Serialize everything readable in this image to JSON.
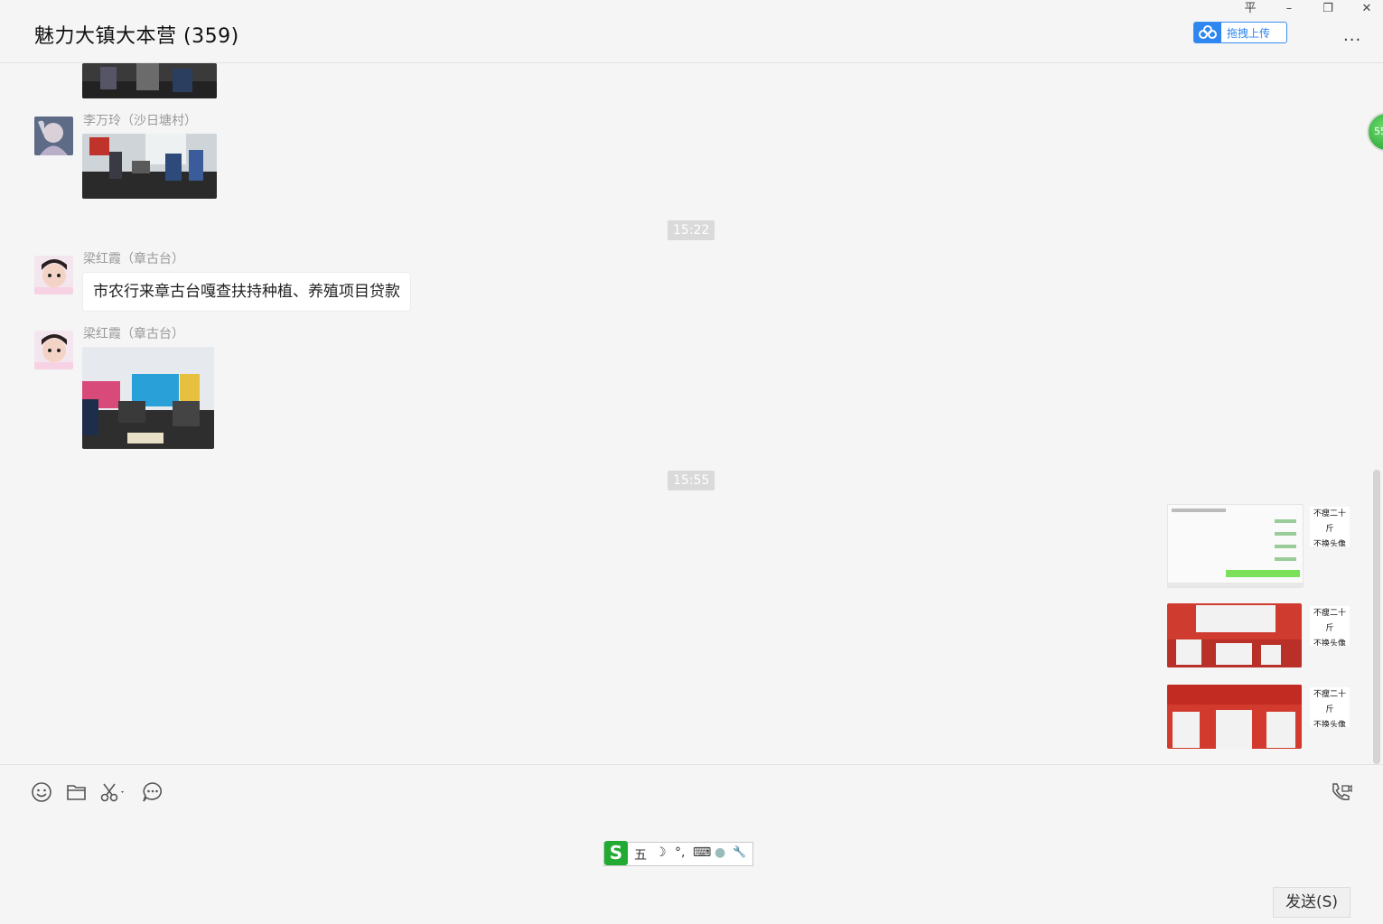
{
  "window": {
    "title": "魅力大镇大本营 (359)",
    "pin_glyph": "平",
    "minimize_glyph": "–",
    "maximize_glyph": "❐",
    "close_glyph": "✕",
    "upload_label": "拖拽上传",
    "more_glyph": "···"
  },
  "float_badge": "55",
  "messages": [
    {
      "sender": "李万玲（沙日塘村）"
    },
    {
      "time": "15:22"
    },
    {
      "sender": "梁红霞（章古台）",
      "text": "市农行来章古台嘎查扶持种植、养殖项目贷款"
    },
    {
      "sender": "梁红霞（章古台）"
    },
    {
      "time": "15:55"
    }
  ],
  "self_avatar": {
    "line1": "不瘦二十斤",
    "line2": "不换头像"
  },
  "ime": {
    "logo": "S",
    "mode": "五",
    "moon": "☽",
    "punct": "°,",
    "keyboard": "⌨",
    "user": "●",
    "wrench": "🔧"
  },
  "send_button": "发送(S)",
  "colors": {
    "accent": "#2e86f0",
    "ime_green": "#22aa33"
  }
}
